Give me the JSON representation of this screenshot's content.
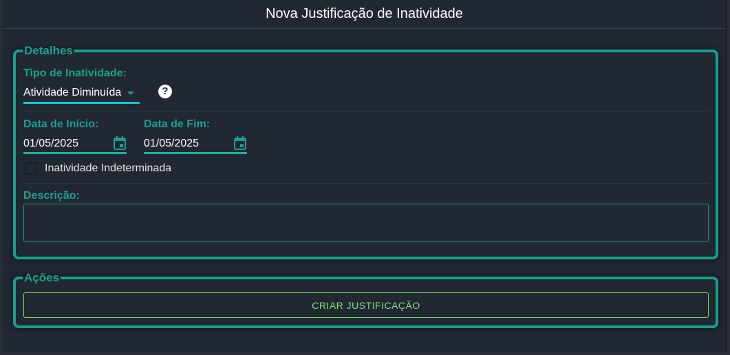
{
  "dialog": {
    "title": "Nova Justificação de Inatividade"
  },
  "details": {
    "legend": "Detalhes",
    "type": {
      "label": "Tipo de Inatividade:",
      "value": "Atividade Diminuída"
    },
    "start": {
      "label": "Data de Início:",
      "value": "01/05/2025"
    },
    "end": {
      "label": "Data de Fim:",
      "value": "01/05/2025"
    },
    "indefinite": {
      "label": "Inatividade Indeterminada",
      "checked": false
    },
    "description": {
      "label": "Descrição:",
      "value": ""
    }
  },
  "actions": {
    "legend": "Ações",
    "create_label": "CRIAR JUSTIFICAÇÃO"
  },
  "colors": {
    "accent": "#12a08c",
    "button_accent": "#72e06a",
    "select_underline": "#0fc6d6",
    "background": "#222832"
  }
}
